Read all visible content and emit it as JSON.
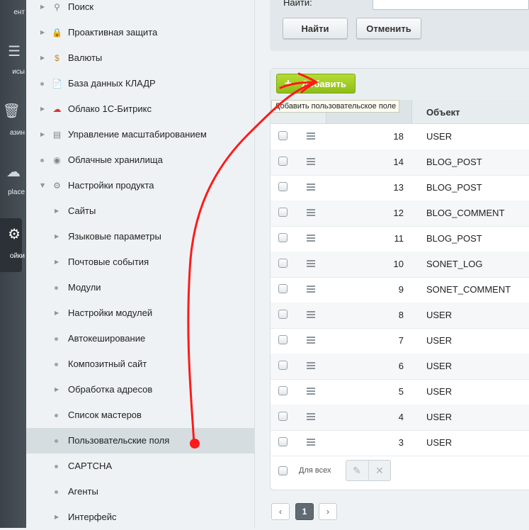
{
  "rail": {
    "items": [
      {
        "label": "ент",
        "icon": "content-icon"
      },
      {
        "label": "исы",
        "icon": "services-icon"
      },
      {
        "label": "азин",
        "icon": "store-icon"
      },
      {
        "label": "place",
        "icon": "marketplace-icon"
      },
      {
        "label": "ойки",
        "icon": "settings-icon"
      }
    ]
  },
  "menu": {
    "items": [
      {
        "label": "Поиск",
        "level": 0,
        "marker": "arrow",
        "icon": "search-icon"
      },
      {
        "label": "Проактивная защита",
        "level": 0,
        "marker": "arrow",
        "icon": "lock-icon"
      },
      {
        "label": "Валюты",
        "level": 0,
        "marker": "arrow",
        "icon": "currency-icon"
      },
      {
        "label": "База данных КЛАДР",
        "level": 0,
        "marker": "dot",
        "icon": "document-icon"
      },
      {
        "label": "Облако 1С-Битрикс",
        "level": 0,
        "marker": "arrow",
        "icon": "cloud-icon"
      },
      {
        "label": "Управление масштабированием",
        "level": 0,
        "marker": "arrow",
        "icon": "server-icon"
      },
      {
        "label": "Облачные хранилища",
        "level": 0,
        "marker": "dot",
        "icon": "storage-icon"
      },
      {
        "label": "Настройки продукта",
        "level": 0,
        "marker": "open",
        "icon": "gear-icon"
      },
      {
        "label": "Сайты",
        "level": 1,
        "marker": "arrow"
      },
      {
        "label": "Языковые параметры",
        "level": 1,
        "marker": "arrow"
      },
      {
        "label": "Почтовые события",
        "level": 1,
        "marker": "arrow"
      },
      {
        "label": "Модули",
        "level": 1,
        "marker": "dot"
      },
      {
        "label": "Настройки модулей",
        "level": 1,
        "marker": "arrow"
      },
      {
        "label": "Автокеширование",
        "level": 1,
        "marker": "dot"
      },
      {
        "label": "Композитный сайт",
        "level": 1,
        "marker": "dot"
      },
      {
        "label": "Обработка адресов",
        "level": 1,
        "marker": "arrow"
      },
      {
        "label": "Список мастеров",
        "level": 1,
        "marker": "dot"
      },
      {
        "label": "Пользовательские поля",
        "level": 1,
        "marker": "dot",
        "active": true
      },
      {
        "label": "CAPTCHA",
        "level": 1,
        "marker": "dot"
      },
      {
        "label": "Агенты",
        "level": 1,
        "marker": "dot"
      },
      {
        "label": "Интерфейс",
        "level": 1,
        "marker": "arrow"
      }
    ]
  },
  "filter": {
    "find_label": "Найти:",
    "find_value": "",
    "find_button": "Найти",
    "cancel_button": "Отменить"
  },
  "grid": {
    "add_button": "Добавить",
    "add_tooltip": "Добавить пользовательское поле",
    "column_object": "Объект",
    "rows": [
      {
        "id": "18",
        "object": "USER"
      },
      {
        "id": "14",
        "object": "BLOG_POST"
      },
      {
        "id": "13",
        "object": "BLOG_POST"
      },
      {
        "id": "12",
        "object": "BLOG_COMMENT"
      },
      {
        "id": "11",
        "object": "BLOG_POST"
      },
      {
        "id": "10",
        "object": "SONET_LOG"
      },
      {
        "id": "9",
        "object": "SONET_COMMENT"
      },
      {
        "id": "8",
        "object": "USER"
      },
      {
        "id": "7",
        "object": "USER"
      },
      {
        "id": "6",
        "object": "USER"
      },
      {
        "id": "5",
        "object": "USER"
      },
      {
        "id": "4",
        "object": "USER"
      },
      {
        "id": "3",
        "object": "USER"
      }
    ],
    "for_all_label": "Для всех"
  },
  "pagination": {
    "prev": "‹",
    "current": "1",
    "next": "›"
  },
  "colors": {
    "add_green": "#9ccb22",
    "annotation_red": "#ff1a1a",
    "rail_dark": "#3f474d"
  }
}
